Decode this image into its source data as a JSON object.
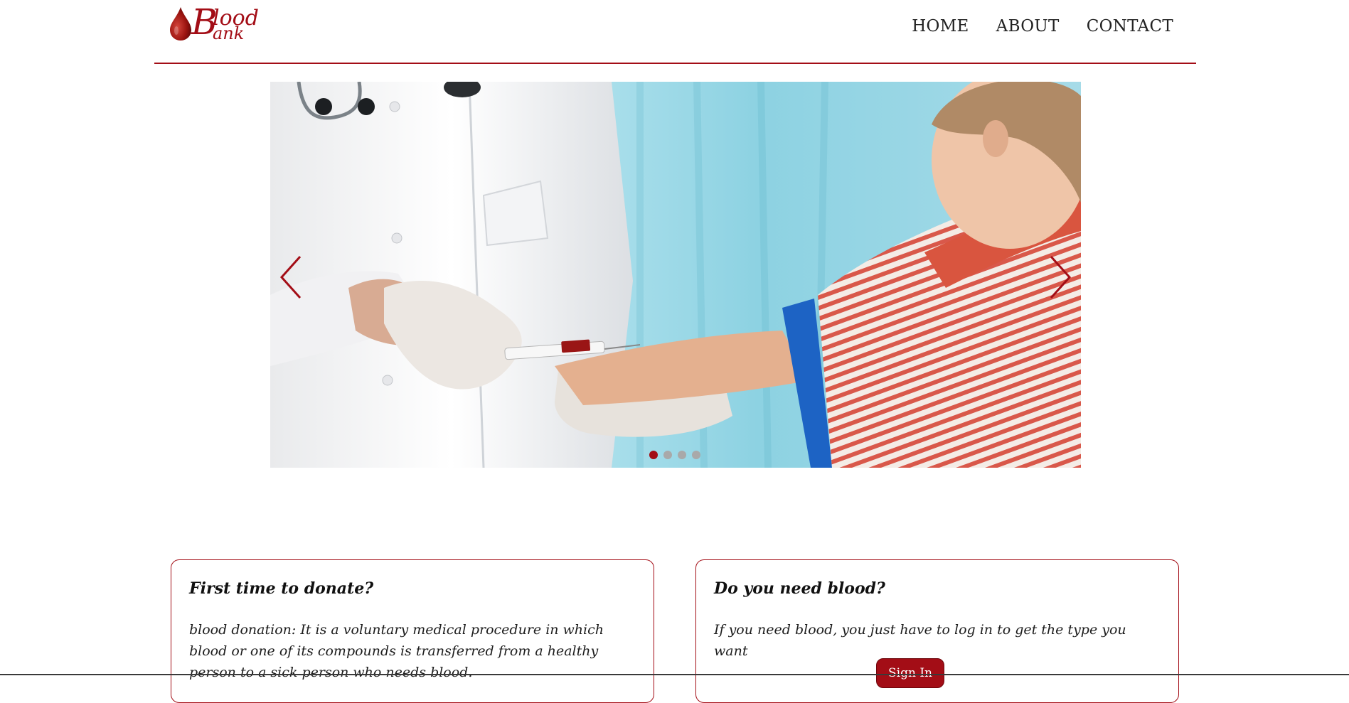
{
  "logo": {
    "word_first": "B",
    "word_top": "lood",
    "word_bottom": "ank",
    "brand_color": "#a30d16"
  },
  "nav": {
    "items": [
      "HOME",
      "ABOUT",
      "CONTACT"
    ]
  },
  "carousel": {
    "slide_count": 4,
    "active_index": 0,
    "prev_icon": "chevron-left",
    "next_icon": "chevron-right"
  },
  "cards": {
    "donate": {
      "title": "First time to donate?",
      "text": "blood donation: It is a voluntary medical procedure in which blood or one of its compounds is transferred from a healthy person to a sick person who needs blood."
    },
    "need": {
      "title": "Do you need blood?",
      "text": "If you need blood, you just have to log in to get the type you want",
      "button_label": "Sign In"
    }
  },
  "colors": {
    "accent": "#a30d16",
    "text": "#1a1a1a"
  }
}
